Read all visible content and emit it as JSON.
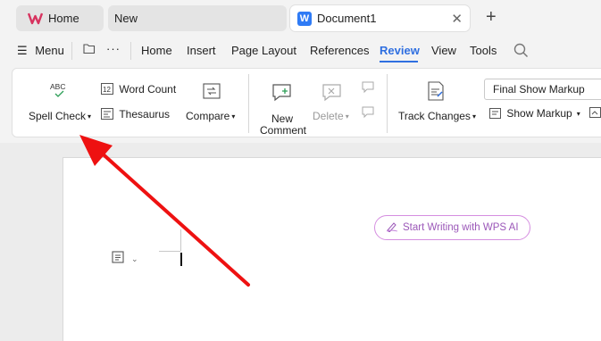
{
  "tabs": {
    "home_label": "Home",
    "new_label": "New",
    "doc_label": "Document1",
    "doc_logo_letter": "W"
  },
  "menu": {
    "menu_label": "Menu",
    "items": [
      "Home",
      "Insert",
      "Page Layout",
      "References",
      "Review",
      "View",
      "Tools"
    ],
    "active": "Review"
  },
  "ribbon": {
    "spell_check": "Spell Check",
    "word_count": "Word Count",
    "thesaurus": "Thesaurus",
    "compare": "Compare",
    "new_comment_line1": "New",
    "new_comment_line2": "Comment",
    "delete": "Delete",
    "track_changes": "Track Changes",
    "markup_mode": "Final Show Markup",
    "show_markup": "Show Markup"
  },
  "document": {
    "ai_prompt": "Start Writing with WPS AI"
  },
  "colors": {
    "accent": "#2f6fe0",
    "annotation_arrow": "#ee1111",
    "ai_pill": "#9b57b8"
  }
}
